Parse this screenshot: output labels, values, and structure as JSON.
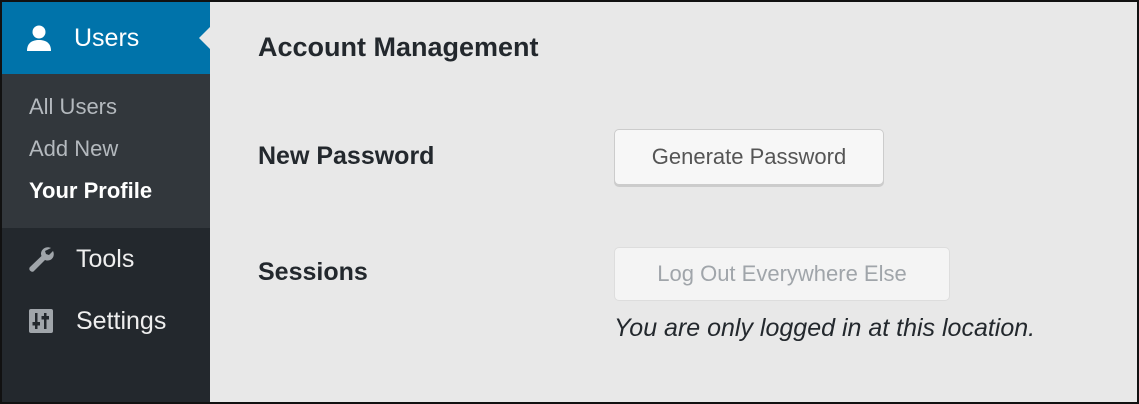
{
  "sidebar": {
    "current_menu": {
      "label": "Users",
      "icon": "users-icon"
    },
    "submenu": [
      {
        "label": "All Users"
      },
      {
        "label": "Add New"
      },
      {
        "label": "Your Profile",
        "current": true
      }
    ],
    "menu_items": [
      {
        "label": "Tools",
        "icon": "wrench-icon"
      },
      {
        "label": "Settings",
        "icon": "settings-sliders-icon"
      }
    ],
    "colors": {
      "background": "#23282d",
      "submenu_background": "#32373c",
      "current_background": "#0073aa"
    }
  },
  "main": {
    "section_title": "Account Management",
    "new_password": {
      "label": "New Password",
      "button_label": "Generate Password"
    },
    "sessions": {
      "label": "Sessions",
      "button_label": "Log Out Everywhere Else",
      "note": "You are only logged in at this location."
    },
    "background": "#e8e8e8"
  }
}
